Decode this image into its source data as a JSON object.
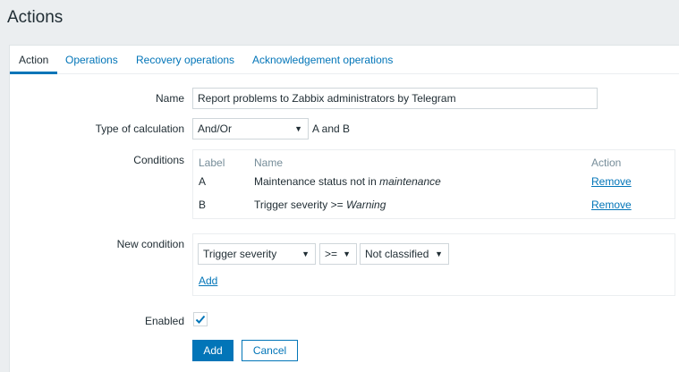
{
  "page": {
    "title": "Actions"
  },
  "tabs": [
    {
      "label": "Action"
    },
    {
      "label": "Operations"
    },
    {
      "label": "Recovery operations"
    },
    {
      "label": "Acknowledgement operations"
    }
  ],
  "form": {
    "name_label": "Name",
    "name_value": "Report problems to Zabbix administrators by Telegram",
    "calc_label": "Type of calculation",
    "calc_value": "And/Or",
    "calc_formula": "A and B",
    "conditions_label": "Conditions",
    "conditions_headers": {
      "label": "Label",
      "name": "Name",
      "action": "Action"
    },
    "conditions": [
      {
        "label": "A",
        "name_prefix": "Maintenance status not in ",
        "name_em": "maintenance",
        "action": "Remove"
      },
      {
        "label": "B",
        "name_prefix": "Trigger severity >= ",
        "name_em": "Warning",
        "action": "Remove"
      }
    ],
    "new_condition_label": "New condition",
    "new_condition": {
      "type": "Trigger severity",
      "operator": ">=",
      "value": "Not classified",
      "add_link": "Add"
    },
    "enabled_label": "Enabled",
    "enabled": true,
    "add_button": "Add",
    "cancel_button": "Cancel"
  },
  "colors": {
    "accent": "#0275b8",
    "background": "#ebeef0",
    "text": "#1f2c33",
    "muted": "#768d99"
  }
}
